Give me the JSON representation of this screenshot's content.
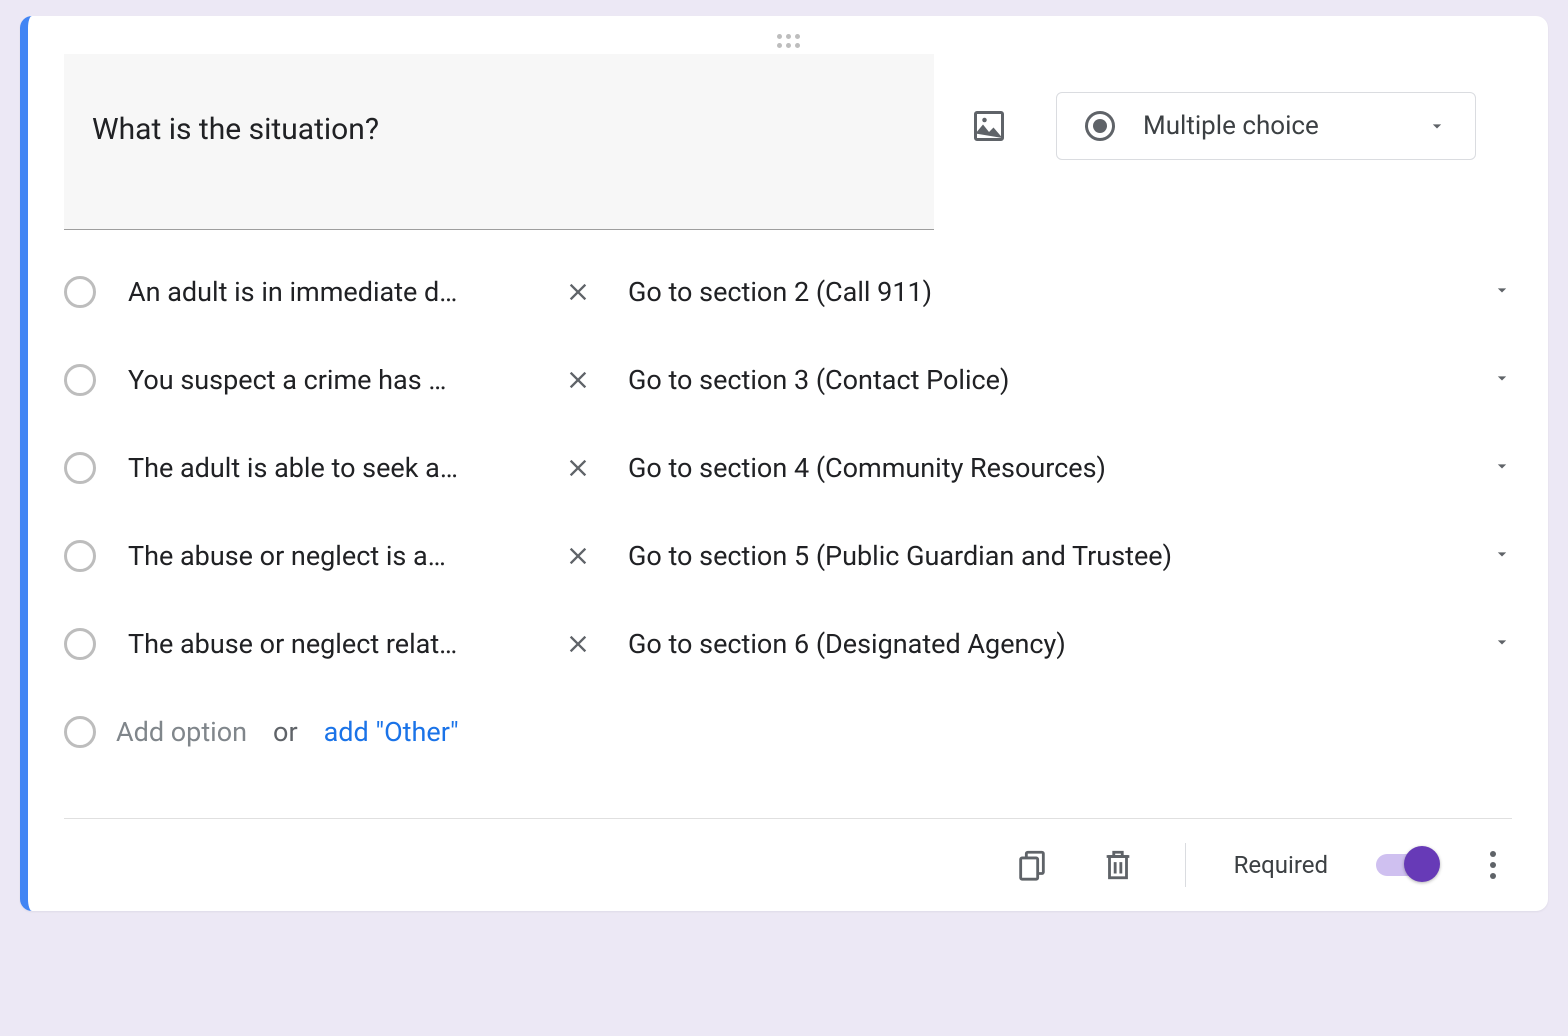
{
  "question": {
    "text": "What is the situation?",
    "type_label": "Multiple choice"
  },
  "options": [
    {
      "label": "An adult is in immediate d…",
      "goto": "Go to section 2 (Call 911)"
    },
    {
      "label": "You suspect a crime has …",
      "goto": "Go to section 3 (Contact Police)"
    },
    {
      "label": "The adult is able to seek a…",
      "goto": "Go to section 4 (Community Resources)"
    },
    {
      "label": "The abuse or neglect is a…",
      "goto": "Go to section 5 (Public Guardian and Trustee)"
    },
    {
      "label": "The abuse or neglect relat…",
      "goto": "Go to section 6 (Designated Agency)"
    }
  ],
  "add_row": {
    "add_option": "Add option",
    "or": "or",
    "add_other": "add \"Other\""
  },
  "footer": {
    "required_label": "Required",
    "required_on": true
  }
}
